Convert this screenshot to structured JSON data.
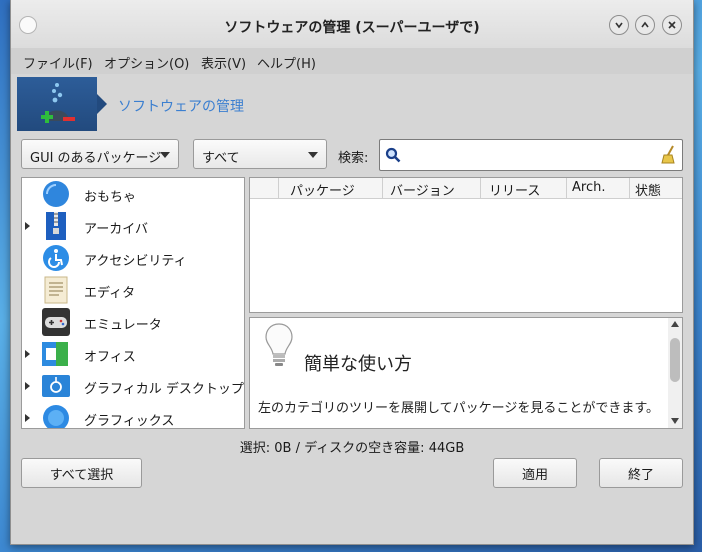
{
  "window": {
    "title": "ソフトウェアの管理 (スーパーユーザで)",
    "controls": [
      "minimize",
      "maximize",
      "close"
    ]
  },
  "menu": {
    "file": "ファイル(F)",
    "options": "オプション(O)",
    "view": "表示(V)",
    "help": "ヘルプ(H)"
  },
  "banner": {
    "title": "ソフトウェアの管理"
  },
  "filters": {
    "gui_filter": "GUI のあるパッケージ",
    "status_filter": "すべて",
    "search_label": "検索:",
    "search_value": ""
  },
  "categories": [
    {
      "label": "おもちゃ",
      "expandable": false,
      "icon": "toys-icon"
    },
    {
      "label": "アーカイバ",
      "expandable": true,
      "icon": "archiver-icon"
    },
    {
      "label": "アクセシビリティ",
      "expandable": false,
      "icon": "accessibility-icon"
    },
    {
      "label": "エディタ",
      "expandable": false,
      "icon": "editor-icon"
    },
    {
      "label": "エミュレータ",
      "expandable": false,
      "icon": "emulator-icon"
    },
    {
      "label": "オフィス",
      "expandable": true,
      "icon": "office-icon"
    },
    {
      "label": "グラフィカル デスクトップ",
      "expandable": true,
      "icon": "desktop-icon"
    },
    {
      "label": "グラフィックス",
      "expandable": true,
      "icon": "graphics-icon"
    }
  ],
  "packages": {
    "columns": [
      "パッケージ",
      "バージョン",
      "リリース",
      "Arch.",
      "状態"
    ],
    "rows": []
  },
  "help": {
    "title": "簡単な使い方",
    "text": "左のカテゴリのツリーを展開してパッケージを見ることができます。"
  },
  "status": "選択: 0B / ディスクの空き容量: 44GB",
  "buttons": {
    "select_all": "すべて選択",
    "apply": "適用",
    "quit": "終了"
  },
  "colors": {
    "accent": "#3b7fd0"
  }
}
